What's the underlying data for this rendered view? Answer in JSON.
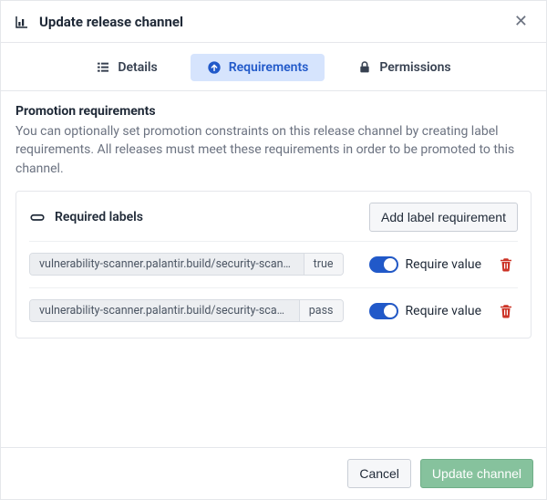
{
  "header": {
    "title": "Update release channel"
  },
  "tabs": {
    "items": [
      {
        "label": "Details",
        "icon": "details",
        "active": false
      },
      {
        "label": "Requirements",
        "icon": "upload-circle",
        "active": true
      },
      {
        "label": "Permissions",
        "icon": "lock",
        "active": false
      }
    ]
  },
  "section": {
    "heading": "Promotion requirements",
    "description": "You can optionally set promotion constraints on this release channel by creating label requirements. All releases must meet these requirements in order to be promoted to this channel."
  },
  "panel": {
    "title": "Required labels",
    "add_button": "Add label requirement",
    "toggle_label": "Require value",
    "rows": [
      {
        "key": "vulnerability-scanner.palantir.build/security-scanned",
        "value": "true",
        "require_value": true
      },
      {
        "key": "vulnerability-scanner.palantir.build/security-scan-outcome",
        "value": "pass",
        "require_value": true
      }
    ]
  },
  "footer": {
    "cancel": "Cancel",
    "submit": "Update channel"
  }
}
